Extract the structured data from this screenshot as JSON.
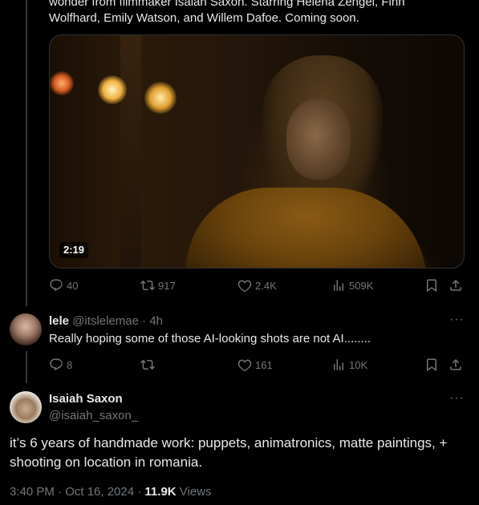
{
  "top_tweet": {
    "text_line1": "wonder from filmmaker Isaiah Saxon. Starring Helena Zengel, Finn",
    "text_line2": "Wolfhard, Emily Watson, and Willem Dafoe. Coming soon.",
    "video": {
      "duration": "2:19"
    },
    "actions": {
      "replies": "40",
      "reposts": "917",
      "likes": "2.4K",
      "views": "509K"
    }
  },
  "reply": {
    "name": "lele",
    "handle": "@itslelemae",
    "separator": "·",
    "time": "4h",
    "text": "Really hoping some of those AI-looking shots are not AI........",
    "actions": {
      "replies": "8",
      "reposts": "",
      "likes": "161",
      "views": "10K"
    }
  },
  "main_tweet": {
    "name": "Isaiah Saxon",
    "handle": "@isaiah_saxon_",
    "text": "it’s 6 years of handmade work: puppets, animatronics, matte paintings, + shooting on location in romania.",
    "time": "3:40 PM · Oct 16, 2024 · ",
    "views_count": "11.9K",
    "views_label": " Views"
  },
  "icons": {
    "reply": "reply-icon",
    "repost": "repost-icon",
    "like": "heart-icon",
    "views": "views-icon",
    "bookmark": "bookmark-icon",
    "share": "share-icon",
    "more": "more-icon"
  },
  "colors": {
    "background": "#000000",
    "text": "#e7e9ea",
    "muted": "#71767b",
    "border": "#2f3336"
  }
}
